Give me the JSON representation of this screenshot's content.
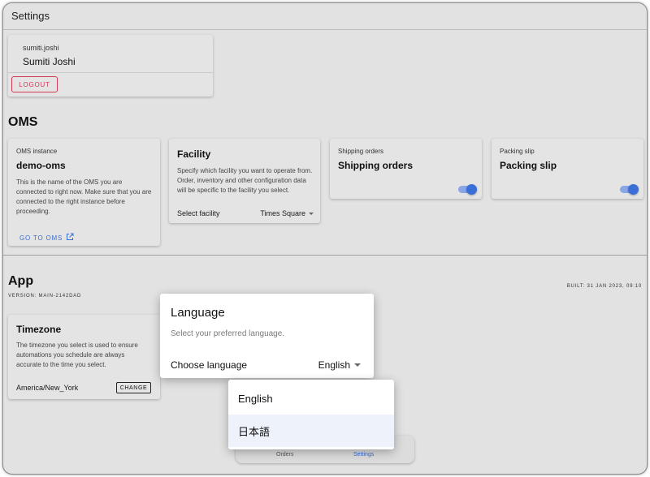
{
  "header": {
    "title": "Settings"
  },
  "user": {
    "username": "sumiti.joshi",
    "full_name": "Sumiti Joshi",
    "logout_label": "LOGOUT"
  },
  "oms_section": {
    "title": "OMS",
    "instance": {
      "label": "OMS instance",
      "name": "demo-oms",
      "description": "This is the name of the OMS you are connected to right now. Make sure that you are connected to the right instance before proceeding.",
      "link_label": "GO TO OMS",
      "link_icon": "external-link-icon"
    },
    "facility": {
      "title": "Facility",
      "description": "Specify which facility you want to operate from. Order, inventory and other configuration data will be specific to the facility you select.",
      "select_label": "Select facility",
      "selected": "Times Square"
    },
    "shipping": {
      "label": "Shipping orders",
      "title": "Shipping orders",
      "enabled": true
    },
    "packing": {
      "label": "Packing slip",
      "title": "Packing slip",
      "enabled": true
    }
  },
  "app_section": {
    "title": "App",
    "version": "VERSION: MAIN-2142DAD",
    "built": "BUILT: 31 JAN 2023, 09:10",
    "timezone": {
      "title": "Timezone",
      "description": "The timezone you select is used to ensure automations you schedule are always accurate to the time you select.",
      "value": "America/New_York",
      "change_label": "CHANGE"
    }
  },
  "language_popover": {
    "title": "Language",
    "subtitle": "Select your preferred language.",
    "label": "Choose language",
    "selected": "English",
    "options": [
      "English",
      "日本語"
    ],
    "highlighted_option": "日本語"
  },
  "bottom_nav": {
    "items": [
      "Orders",
      "Settings"
    ],
    "active": "Settings"
  },
  "colors": {
    "accent": "#3a6fd8",
    "danger": "#d23b55",
    "background": "#e2e2e2",
    "surface": "#ffffff"
  }
}
